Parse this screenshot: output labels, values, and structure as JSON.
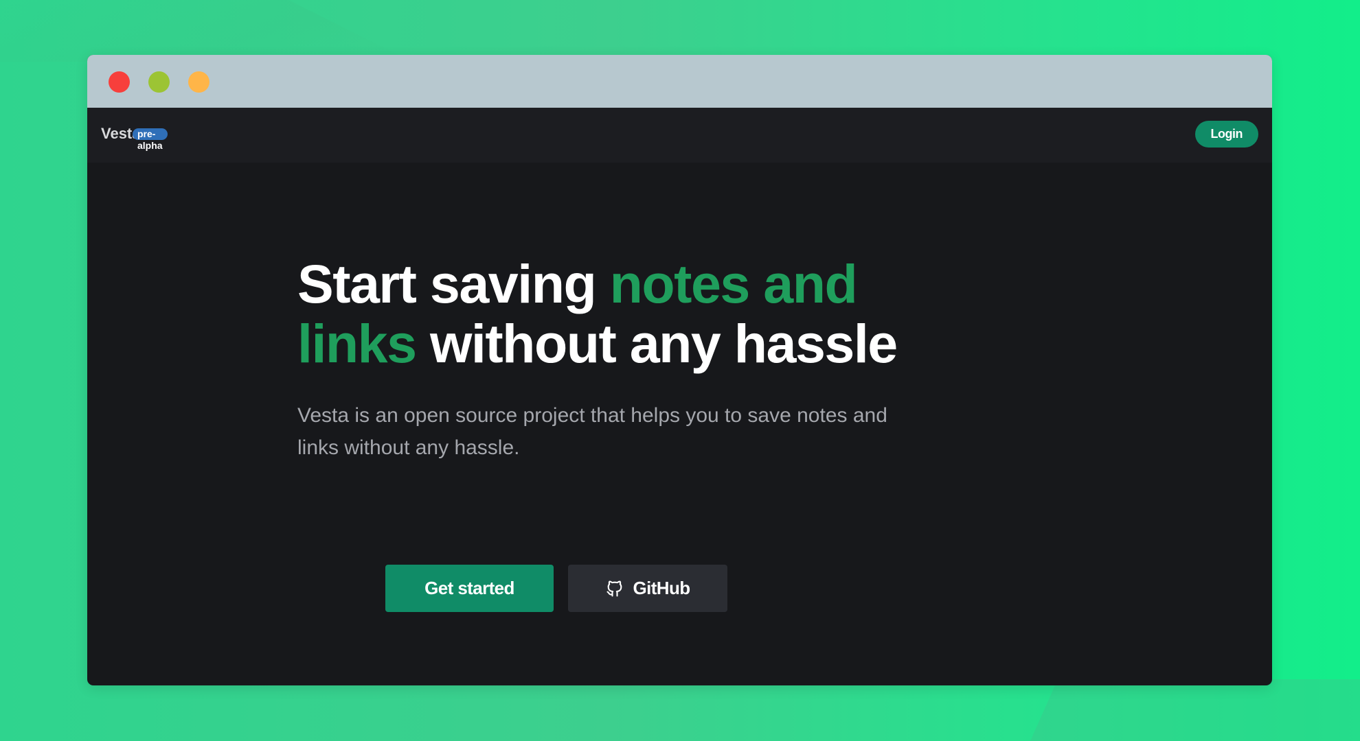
{
  "navbar": {
    "brand": "Vesta",
    "badge": "pre-alpha",
    "login_label": "Login"
  },
  "hero": {
    "headline": {
      "part1": "Start saving ",
      "accent": "notes and links",
      "part2": " without any hassle"
    },
    "subtitle": "Vesta is an open source project that helps you to save notes and links without any hassle."
  },
  "actions": {
    "primary_label": "Get started",
    "secondary_label": "GitHub",
    "secondary_icon": "github-icon"
  },
  "colors": {
    "accent": "#1f9e5c",
    "button": "#108c67",
    "badge": "#2f6fb8",
    "window_dots": [
      "#f73f3c",
      "#9cc434",
      "#ffb548"
    ]
  }
}
